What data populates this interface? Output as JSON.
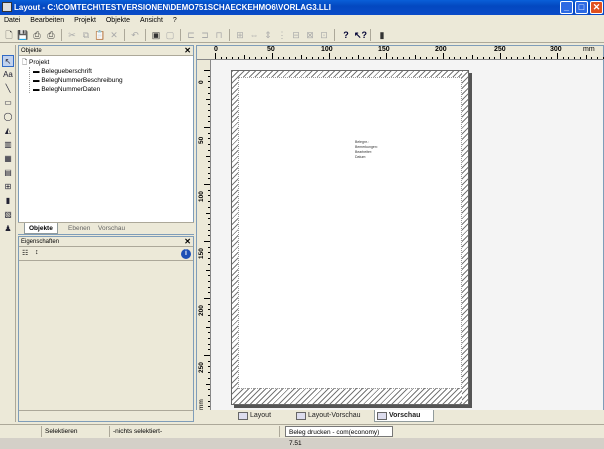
{
  "window": {
    "title": "Layout - C:\\COMTECH\\TESTVERSIONEN\\DEMO751SCHAECKEHMO6\\VORLAG3.LLI",
    "min_label": "_",
    "max_label": "□",
    "close_label": "✕"
  },
  "menu": [
    "Datei",
    "Bearbeiten",
    "Projekt",
    "Objekte",
    "Ansicht",
    "?"
  ],
  "objects_panel": {
    "title": "Objekte",
    "close": "✕",
    "root": "Projekt",
    "items": [
      "Belegueberschrift",
      "BelegNummerBeschreibung",
      "BelegNummerDaten"
    ],
    "tabs": [
      "Objekte",
      "Ebenen",
      "Vorschau"
    ]
  },
  "properties_panel": {
    "title": "Eigenschaften",
    "close": "✕",
    "info": "i"
  },
  "ruler": {
    "h_labels": [
      "0",
      "50",
      "100",
      "150",
      "200",
      "250",
      "300",
      "mm"
    ],
    "v_labels": [
      "0",
      "50",
      "100",
      "150",
      "200",
      "250",
      "mm"
    ]
  },
  "page_text": [
    "Belegnr.:",
    "Bemerkungen:",
    "Bearbeiter:",
    "Datum:"
  ],
  "view_tabs": [
    "Layout",
    "Layout-Vorschau",
    "Vorschau"
  ],
  "status": {
    "mode": "Selektieren",
    "selection": "-nichts selektiert-",
    "print_info": "Beleg drucken - com(economy) 7.51"
  }
}
